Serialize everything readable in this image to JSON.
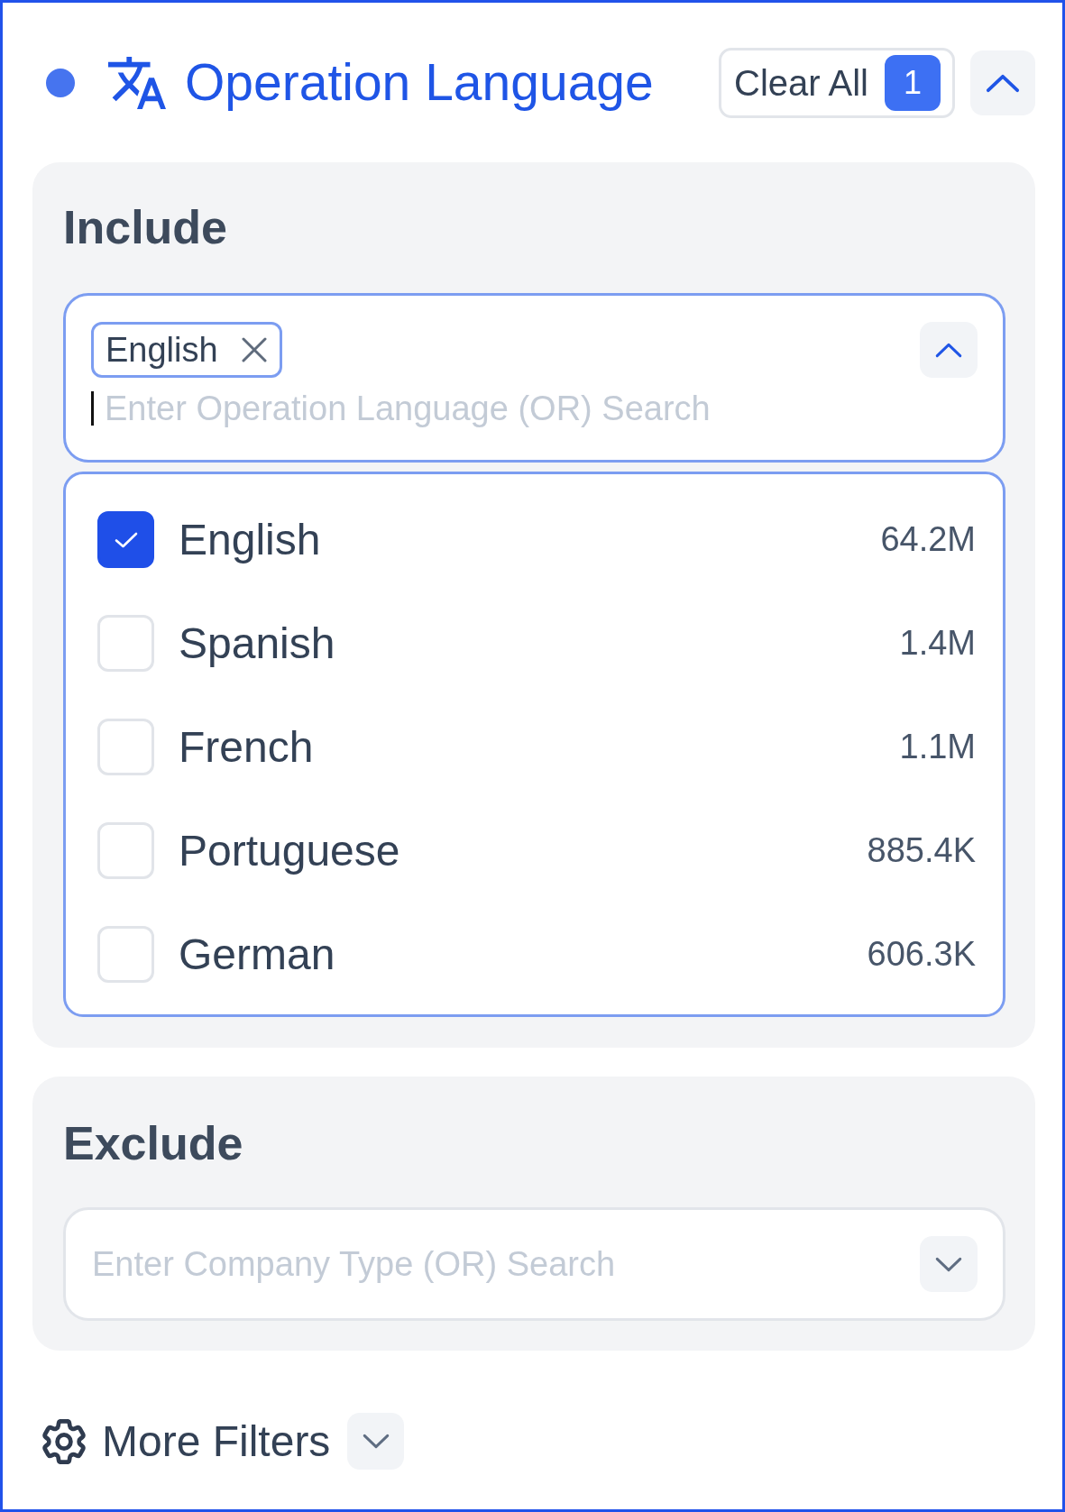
{
  "header": {
    "title": "Operation Language",
    "clear_button": {
      "label": "Clear All",
      "count": "1"
    },
    "expanded": true
  },
  "include": {
    "heading": "Include",
    "field": {
      "focused": true,
      "tags": [
        {
          "label": "English"
        }
      ],
      "placeholder": "Enter Operation Language (OR) Search",
      "expanded": true
    },
    "options": [
      {
        "label": "English",
        "count": "64.2M",
        "checked": true
      },
      {
        "label": "Spanish",
        "count": "1.4M",
        "checked": false
      },
      {
        "label": "French",
        "count": "1.1M",
        "checked": false
      },
      {
        "label": "Portuguese",
        "count": "885.4K",
        "checked": false
      },
      {
        "label": "German",
        "count": "606.3K",
        "checked": false
      }
    ]
  },
  "exclude": {
    "heading": "Exclude",
    "field": {
      "focused": false,
      "placeholder": "Enter Company Type (OR) Search",
      "expanded": false
    }
  },
  "more_filters": {
    "label": "More Filters",
    "expanded": false
  }
}
